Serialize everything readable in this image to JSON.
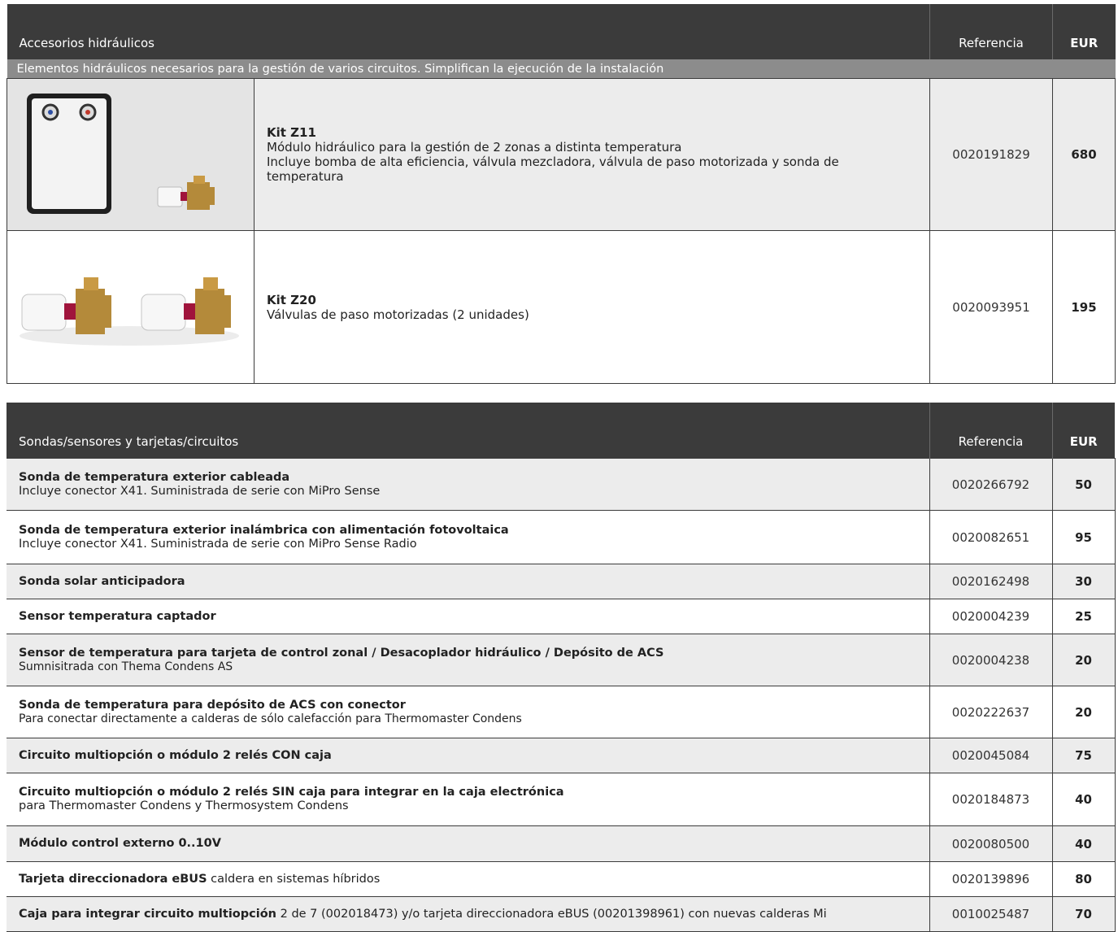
{
  "section1": {
    "header": {
      "title": "Accesorios hidráulicos",
      "ref": "Referencia",
      "eur": "EUR"
    },
    "subheader": "Elementos hidráulicos necesarios para la gestión de varios circuitos. Simplifican la ejecución de la instalación",
    "products": [
      {
        "name": "Kit Z11",
        "line1": "Módulo hidráulico para la gestión de 2 zonas a distinta temperatura",
        "line2": "Incluye bomba de alta eficiencia, válvula mezcladora, válvula de paso motorizada y sonda de temperatura",
        "ref": "0020191829",
        "price": "680"
      },
      {
        "name": "Kit Z20",
        "line1": "Válvulas de paso motorizadas (2 unidades)",
        "ref": "0020093951",
        "price": "195"
      }
    ]
  },
  "section2": {
    "header": {
      "title": "Sondas/sensores y tarjetas/circuitos",
      "ref": "Referencia",
      "eur": "EUR"
    },
    "rows": [
      {
        "title": "Sonda de temperatura exterior cableada",
        "desc": "Incluye conector X41. Suministrada de serie con MiPro Sense",
        "ref": "0020266792",
        "price": "50"
      },
      {
        "title": "Sonda de temperatura exterior inalámbrica con alimentación fotovoltaica",
        "desc": "Incluye conector X41. Suministrada de serie con MiPro Sense Radio",
        "ref": "0020082651",
        "price": "95"
      },
      {
        "title": "Sonda solar anticipadora",
        "ref": "0020162498",
        "price": "30"
      },
      {
        "title": "Sensor temperatura captador",
        "ref": "0020004239",
        "price": "25"
      },
      {
        "title": "Sensor de temperatura para tarjeta de control zonal / Desacoplador hidráulico / Depósito de ACS",
        "desc": "Sumnisitrada con Thema Condens AS",
        "ref": "0020004238",
        "price": "20"
      },
      {
        "title": "Sonda de temperatura para depósito de ACS con conector",
        "desc": "Para conectar directamente a calderas de sólo calefacción para Thermomaster Condens",
        "ref": "0020222637",
        "price": "20"
      },
      {
        "title": "Circuito multiopción o módulo 2 relés CON caja",
        "ref": "0020045084",
        "price": "75"
      },
      {
        "title": "Circuito multiopción o módulo 2 relés SIN caja para integrar en la caja electrónica",
        "desc": "para Thermomaster Condens y Thermosystem Condens",
        "ref": "0020184873",
        "price": "40"
      },
      {
        "title": "Módulo control externo 0..10V",
        "ref": "0020080500",
        "price": "40"
      },
      {
        "title": "Tarjeta direccionadora eBUS",
        "inline": " caldera en sistemas híbridos",
        "ref": "0020139896",
        "price": "80"
      },
      {
        "title": "Caja para integrar circuito multiopción",
        "inline": " 2 de 7 (002018473) y/o tarjeta direccionadora eBUS (00201398961) con nuevas calderas Mi",
        "ref": "0010025487",
        "price": "70"
      }
    ]
  }
}
